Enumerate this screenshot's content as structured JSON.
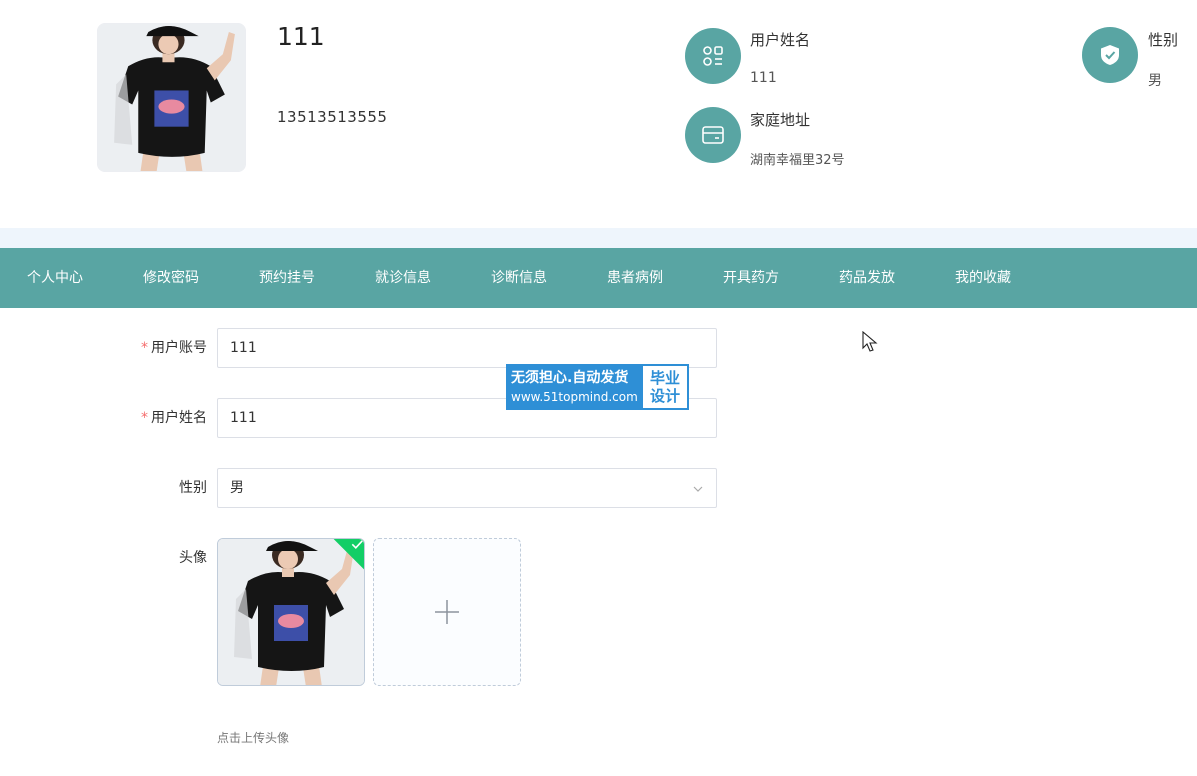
{
  "profile": {
    "name": "111",
    "phone": "13513513555",
    "info": [
      {
        "label": "用户姓名",
        "value": "111",
        "icon": "apps-icon"
      },
      {
        "label": "性别",
        "value": "男",
        "icon": "shield-check-icon"
      },
      {
        "label": "家庭地址",
        "value": "湖南幸福里32号",
        "icon": "card-icon"
      }
    ]
  },
  "nav": {
    "items": [
      "个人中心",
      "修改密码",
      "预约挂号",
      "就诊信息",
      "诊断信息",
      "患者病例",
      "开具药方",
      "药品发放",
      "我的收藏"
    ]
  },
  "form": {
    "account_label": "用户账号",
    "account_value": "111",
    "name_label": "用户姓名",
    "name_value": "111",
    "gender_label": "性别",
    "gender_value": "男",
    "avatar_label": "头像",
    "upload_tip": "点击上传头像"
  },
  "watermark": {
    "line1": "无须担心.自动发货",
    "line2": "www.51topmind.com",
    "right1": "毕业",
    "right2": "设计"
  },
  "colors": {
    "accent": "#59a5a3",
    "band": "#eef5fc",
    "required": "#f56c6c",
    "success": "#13ce66",
    "watermark": "#2e8fd6"
  }
}
